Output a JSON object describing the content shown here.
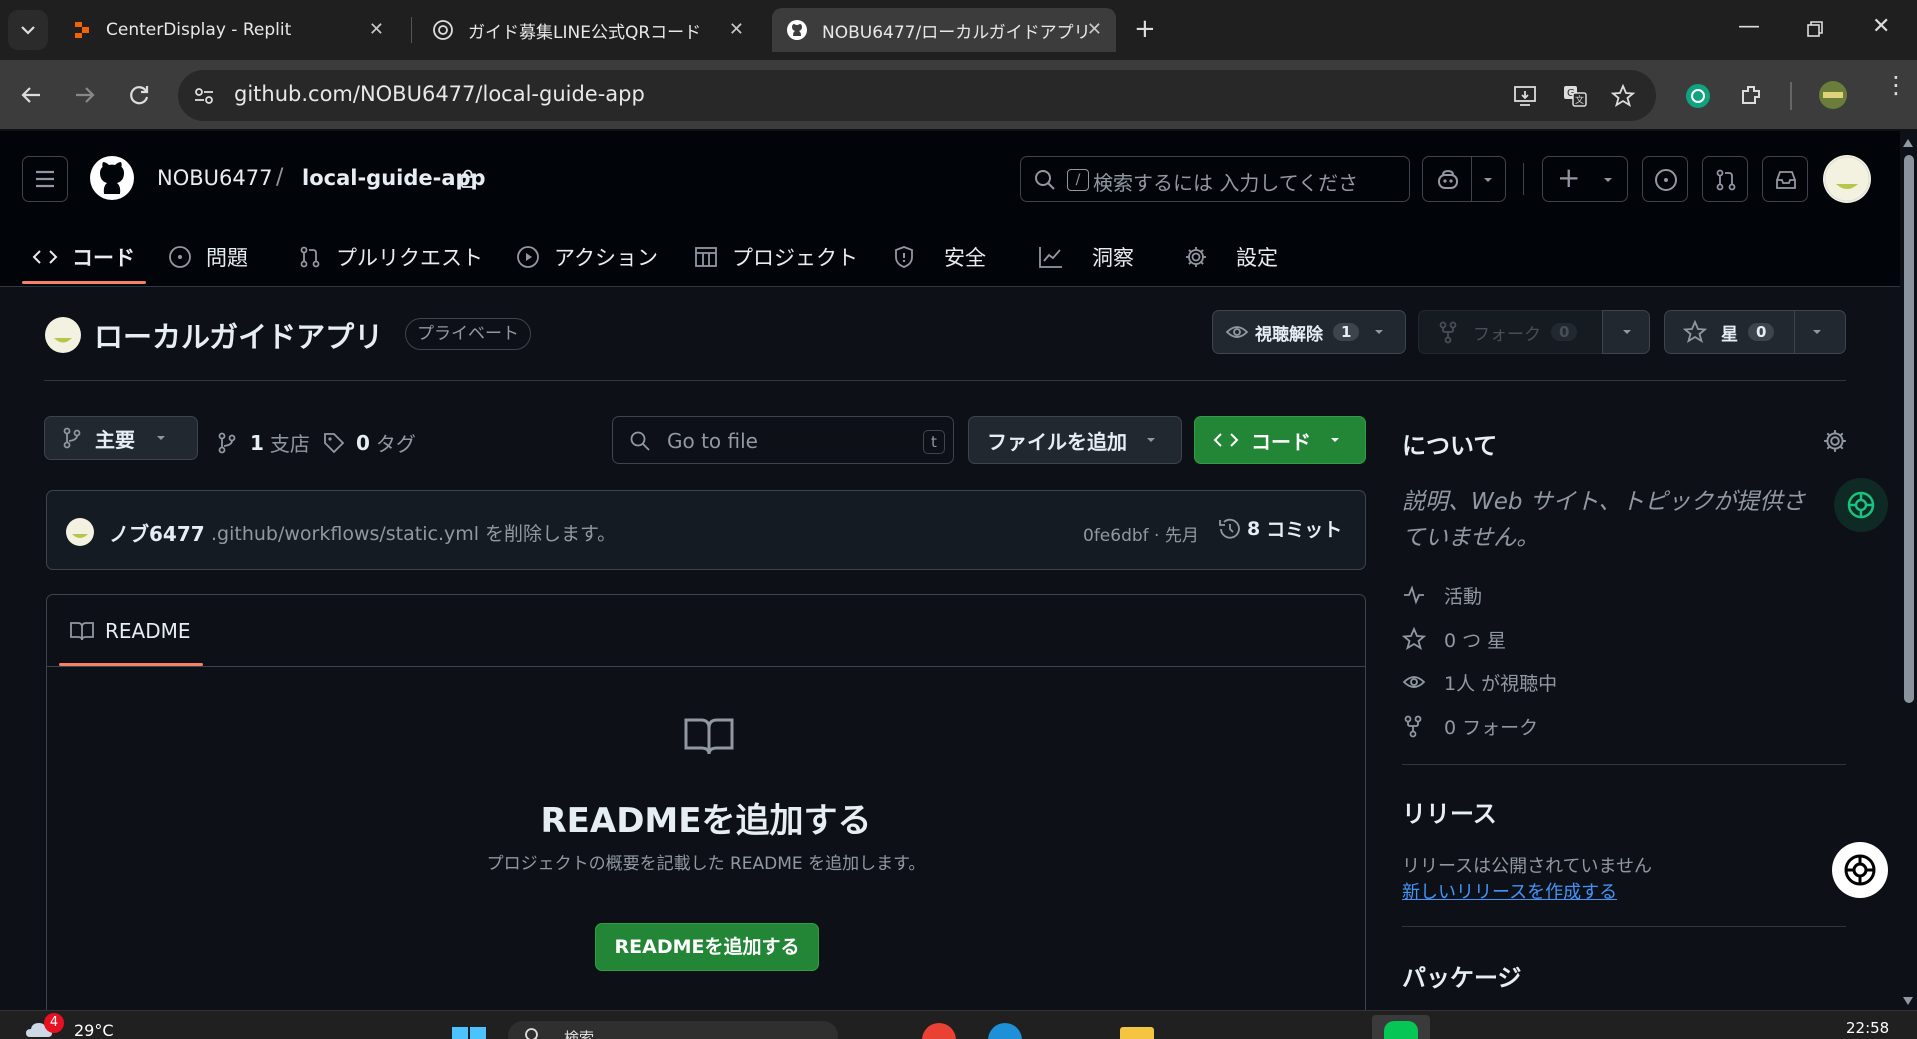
{
  "browser": {
    "tabs": [
      {
        "title": "CenterDisplay - Replit",
        "icon": "replit-icon"
      },
      {
        "title": "ガイド募集LINE公式QRコード",
        "icon": "openai-icon"
      },
      {
        "title": "NOBU6477/ローカルガイドアプリ",
        "icon": "github-icon"
      }
    ],
    "url": "github.com/NOBU6477/local-guide-app"
  },
  "header": {
    "owner": "NOBU6477",
    "separator": "/",
    "repo": "local-guide-app",
    "search_placeholder": "検索するには 入力してくださ",
    "search_key": "/"
  },
  "nav": {
    "tabs": [
      {
        "label": "コード",
        "icon": "code-icon"
      },
      {
        "label": "問題",
        "icon": "issue-icon"
      },
      {
        "label": "プルリクエスト",
        "icon": "pull-request-icon"
      },
      {
        "label": "アクション",
        "icon": "play-icon"
      },
      {
        "label": "プロジェクト",
        "icon": "table-icon"
      },
      {
        "label": "安全",
        "icon": "shield-icon"
      },
      {
        "label": "洞察",
        "icon": "graph-icon"
      },
      {
        "label": "設定",
        "icon": "gear-icon"
      }
    ]
  },
  "repo": {
    "title": "ローカルガイドアプリ",
    "visibility": "プライベート",
    "watch_label": "視聴解除",
    "watch_count": "1",
    "fork_label": "フォーク",
    "fork_count": "0",
    "star_label": "星",
    "star_count": "0"
  },
  "filebar": {
    "branch": "主要",
    "branches_count": "1",
    "branches_label": "支店",
    "tags_count": "0",
    "tags_label": "タグ",
    "goto_placeholder": "Go to file",
    "goto_key": "t",
    "add_file": "ファイルを追加",
    "code_button": "コード"
  },
  "commit": {
    "author": "ノブ6477",
    "message": ".github/workflows/static.yml を削除します。",
    "hash_time": "0fe6dbf · 先月",
    "count": "8",
    "count_label": "コミット"
  },
  "readme": {
    "tab_label": "README",
    "heading": "READMEを追加する",
    "description": "プロジェクトの概要を記載した README を追加します。",
    "button": "READMEを追加する"
  },
  "sidebar": {
    "about_heading": "について",
    "about_text_line1": "説明、Web サイト、トピックが提供さ",
    "about_text_line2": "ていません。",
    "activity": "活動",
    "stars": "0 つ 星",
    "watching": "1人 が視聴中",
    "forks": "0 フォーク",
    "releases_heading": "リリース",
    "releases_text": "リリースは公開されていません",
    "releases_link": "新しいリリースを作成する",
    "packages_heading": "パッケージ"
  },
  "taskbar": {
    "weather": "29°C",
    "badge": "4",
    "search": "検索",
    "time": "22:58"
  },
  "colors": {
    "accent_green": "#238636",
    "underline": "#f78166",
    "link": "#4493f8"
  }
}
